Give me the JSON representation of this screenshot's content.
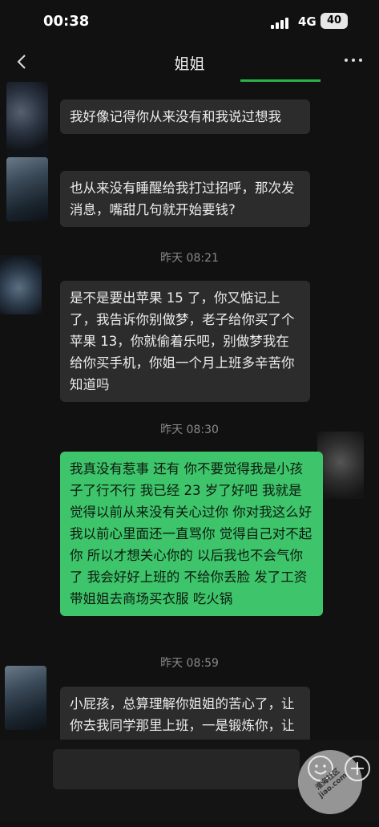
{
  "status_bar": {
    "time": "00:38",
    "network": "4G",
    "battery": "40"
  },
  "header": {
    "title": "姐姐"
  },
  "messages": [
    {
      "text": "我好像记得你从来没有和我说过想我"
    },
    {
      "text": "也从来没有睡醒给我打过招呼，那次发消息，嘴甜几句就开始要钱?"
    },
    {
      "timestamp": "昨天 08:21"
    },
    {
      "text": "是不是要出苹果 15 了，你又惦记上了，我告诉你别做梦，老子给你买了个苹果 13，你就偷着乐吧，别做梦我在给你买手机，你姐一个月上班多辛苦你知道吗"
    },
    {
      "timestamp": "昨天 08:30"
    },
    {
      "text": "我真没有惹事 还有 你不要觉得我是小孩子了行不行 我已经 23 岁了好吧 我就是觉得以前从来没有关心过你 你对我这么好 我以前心里面还一直骂你 觉得自己对不起你 所以才想关心你的 以后我也不会气你了 我会好好上班的 不给你丢脸 发了工资带姐姐去商场买衣服 吃火锅"
    },
    {
      "timestamp": "昨天 08:59"
    },
    {
      "text": "小屁孩，总算理解你姐姐的苦心了，让你去我同学那里上班，一是锻炼你，让你知道挣钱的不容易"
    }
  ],
  "watermark": {
    "text": "淮海社区 jiao.com"
  },
  "colors": {
    "self_bubble": "#3ec46a",
    "other_bubble": "#2c2c2c",
    "background": "#111111"
  }
}
